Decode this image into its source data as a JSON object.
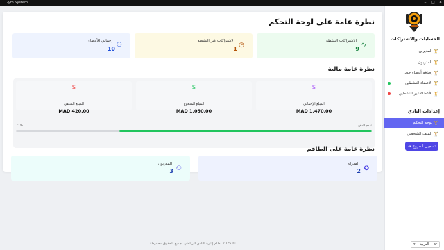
{
  "window": {
    "title": "Gym System",
    "controls": [
      "–",
      "□",
      "✕"
    ]
  },
  "sidebar": {
    "section_members": "الحسابات والاشتراكات",
    "members_items": [
      {
        "label": "المديرين",
        "icon": "manager-icon"
      },
      {
        "label": "المدربون",
        "icon": "trainer-icon"
      },
      {
        "label": "إضافة أعضاء جدد",
        "icon": "add-member-icon"
      },
      {
        "label": "الأعضاء النشطين",
        "icon": "active-members-icon",
        "status_color": "#22c55e"
      },
      {
        "label": "الأعضاء غير النشطين",
        "icon": "inactive-members-icon",
        "status_color": "#ef4444"
      }
    ],
    "section_settings": "إعدادات النادي",
    "settings_items": [
      {
        "label": "لوحة التحكم",
        "icon": "dashboard-icon",
        "active": true
      },
      {
        "label": "الملف الشخصي",
        "icon": "profile-icon",
        "active": false
      }
    ],
    "logout_label": "تسجيل الخروج",
    "language": {
      "selected": "العربية",
      "code": "ar"
    }
  },
  "main": {
    "title": "نظرة عامة على لوحة التحكم",
    "stats": [
      {
        "label": "الاشتراكات النشطة",
        "value": "9",
        "icon": "pulse-icon",
        "bg": "#ecfbef",
        "color": "#15803d"
      },
      {
        "label": "الاشتراكات غير النشطة",
        "value": "1",
        "icon": "clock-icon",
        "bg": "#fdf9e3",
        "color": "#b45309"
      },
      {
        "label": "إجمالي الأعضاء",
        "value": "10",
        "icon": "users-icon",
        "bg": "#eef3fe",
        "color": "#1d4ed8"
      }
    ],
    "finance_title": "نظرة عامة مالية",
    "finance": [
      {
        "label": "المبلغ الإجمالي",
        "amount": "MAD 1,470.00",
        "icon": "dollar-icon",
        "color": "#a855f7"
      },
      {
        "label": "المبلغ المدفوع",
        "amount": "MAD 1,050.00",
        "icon": "dollar-icon",
        "color": "#22c55e"
      },
      {
        "label": "المبلغ المتبقي",
        "amount": "MAD 420.00",
        "icon": "dollar-icon",
        "color": "#ef4444"
      }
    ],
    "progress": {
      "label": "تقدم الدفع",
      "percent_text": "71%",
      "percent": 71,
      "color": "#22c55e"
    },
    "staff_title": "نظرة عامة على الطاقم",
    "staff": [
      {
        "label": "المدراء",
        "value": "2",
        "icon": "award-icon",
        "bg": "#eef2fe"
      },
      {
        "label": "المدربون",
        "value": "3",
        "icon": "trainers-group-icon",
        "bg": "#ecfdfb"
      }
    ]
  },
  "footer": "© 2025 نظام إدارة النادي الرياضي. جميع الحقوق محفوظة."
}
